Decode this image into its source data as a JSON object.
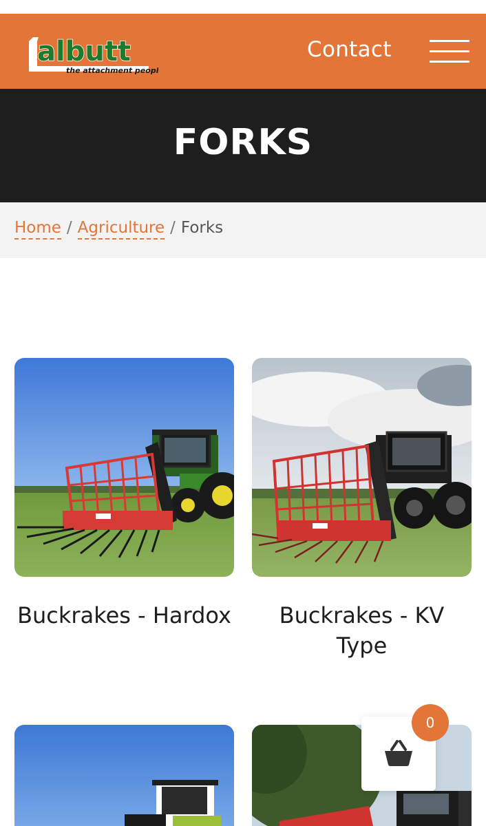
{
  "header": {
    "logo_wordmark": "albutt",
    "logo_tagline": "the attachment people",
    "contact_label": "Contact",
    "menu_icon": "hamburger-menu-icon",
    "brand_color": "#e27537"
  },
  "hero": {
    "title": "FORKS"
  },
  "breadcrumb": {
    "items": [
      {
        "label": "Home"
      },
      {
        "label": "Agriculture"
      }
    ],
    "separator": "/",
    "current": "Forks",
    "link_color": "#e27537"
  },
  "products": [
    {
      "title": "Buckrakes - Hardox",
      "image_icon": "buckrake-hardox-photo"
    },
    {
      "title": "Buckrakes - KV Type",
      "image_icon": "buckrake-kv-type-photo"
    },
    {
      "title": "",
      "image_icon": "product-photo"
    },
    {
      "title": "",
      "image_icon": "product-photo"
    }
  ],
  "cart": {
    "count": "0",
    "icon": "basket-icon"
  }
}
